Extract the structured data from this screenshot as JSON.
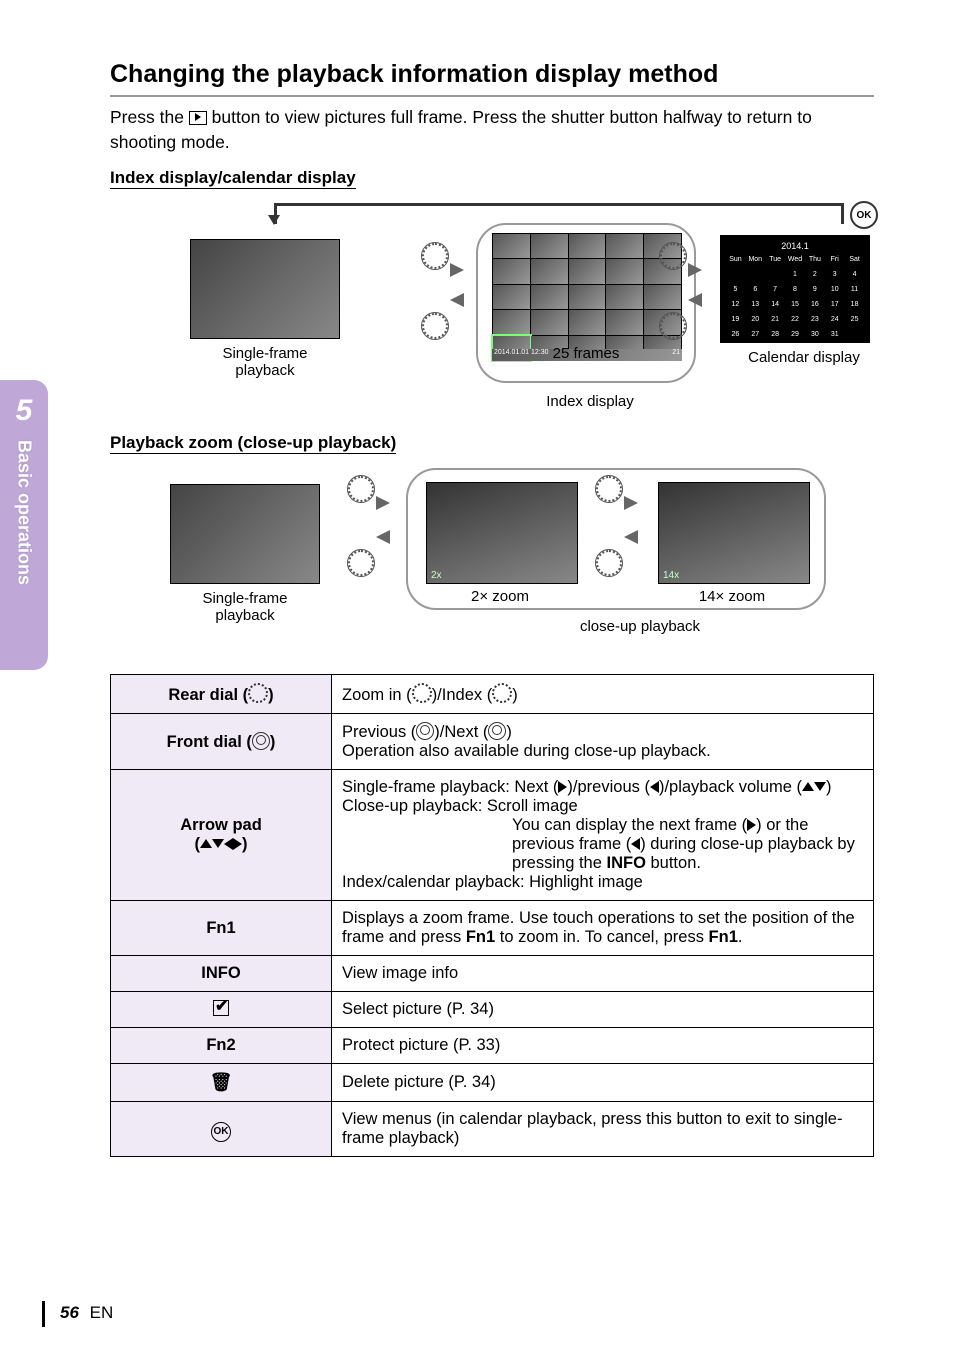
{
  "sideTab": {
    "number": "5",
    "label": "Basic operations"
  },
  "title": "Changing the playback information display method",
  "intro_pre": "Press the ",
  "intro_post": " button to view pictures full frame. Press the shutter button halfway to return to shooting mode.",
  "sub1": "Index display/calendar display",
  "sub2": "Playback zoom (close-up playback)",
  "diag1": {
    "single": "Single-frame playback",
    "frames": "25 frames",
    "indexCaption": "Index display",
    "calendar": "Calendar display",
    "calHeader": "2014.1",
    "calDays": [
      "Sun",
      "Mon",
      "Tue",
      "Wed",
      "Thu",
      "Fri",
      "Sat"
    ],
    "gridFooterLeft": "2014.01.01 12:30",
    "gridFooterRight": "21",
    "ok": "OK"
  },
  "diag2": {
    "single": "Single-frame playback",
    "z2": "2× zoom",
    "z14": "14× zoom",
    "closeup": "close-up playback",
    "z2label": "2x",
    "z14label": "14x"
  },
  "table": {
    "rows": {
      "rear": {
        "label": "Rear dial (",
        "labelEnd": ")",
        "value_pre": "Zoom in (",
        "value_mid": ")/Index (",
        "value_post": ")"
      },
      "front": {
        "label": "Front dial (",
        "labelEnd": ")",
        "line1_pre": "Previous (",
        "line1_mid": ")/Next (",
        "line1_post": ")",
        "line2": "Operation also available during close-up playback."
      },
      "arrow": {
        "label1": "Arrow pad",
        "t1_pre": "Single-frame playback: Next (",
        "t1_mid": ")/previous (",
        "t1_post": ")/playback volume (",
        "t1_end": ")",
        "t2": "Close-up playback: Scroll image",
        "t2b_pre": "You can display the next frame (",
        "t2b_mid": ") or the previous frame (",
        "t2b_post": ") during close-up playback by pressing the ",
        "t2b_btn": "INFO",
        "t2b_end": " button.",
        "t3": "Index/calendar playback: Highlight image"
      },
      "fn1": {
        "label": "Fn1",
        "value_pre": "Displays a zoom frame. Use touch operations to set the position of the frame and press ",
        "b1": "Fn1",
        "mid": " to zoom in. To cancel, press ",
        "b2": "Fn1",
        "end": "."
      },
      "info": {
        "label": "INFO",
        "value": "View image info"
      },
      "sel": {
        "value": "Select picture (P. 34)"
      },
      "fn2": {
        "label": "Fn2",
        "value": "Protect picture (P. 33)"
      },
      "del": {
        "value": "Delete picture (P. 34)"
      },
      "ok": {
        "value": "View menus (in calendar playback, press this button to exit to single-frame playback)",
        "sym": "OK"
      }
    }
  },
  "footer": {
    "page": "56",
    "lang": "EN"
  }
}
